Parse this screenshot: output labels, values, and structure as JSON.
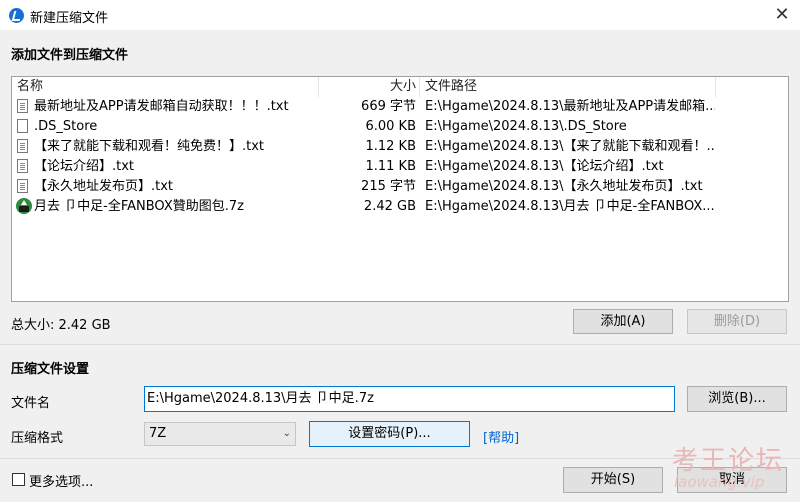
{
  "window": {
    "title": "新建压缩文件",
    "close_glyph": "✕"
  },
  "add_section": {
    "heading": "添加文件到压缩文件",
    "columns": {
      "name": "名称",
      "size": "大小",
      "path": "文件路径"
    },
    "files": [
      {
        "icon": "text-file-icon",
        "name": "最新地址及APP请发邮箱自动获取！！！.txt",
        "size": "669 字节",
        "path": "E:\\Hgame\\2024.8.13\\最新地址及APP请发邮箱..."
      },
      {
        "icon": "blank-file-icon",
        "name": ".DS_Store",
        "size": "6.00 KB",
        "path": "E:\\Hgame\\2024.8.13\\.DS_Store"
      },
      {
        "icon": "text-file-icon",
        "name": "【来了就能下载和观看！纯免费！】.txt",
        "size": "1.12 KB",
        "path": "E:\\Hgame\\2024.8.13\\【来了就能下载和观看！..."
      },
      {
        "icon": "text-file-icon",
        "name": "【论坛介绍】.txt",
        "size": "1.11 KB",
        "path": "E:\\Hgame\\2024.8.13\\【论坛介绍】.txt"
      },
      {
        "icon": "text-file-icon",
        "name": "【永久地址发布页】.txt",
        "size": "215 字节",
        "path": "E:\\Hgame\\2024.8.13\\【永久地址发布页】.txt"
      },
      {
        "icon": "7z-archive-icon",
        "name": "月去 卩中足-全FANBOX贊助图包.7z",
        "size": "2.42 GB",
        "path": "E:\\Hgame\\2024.8.13\\月去 卩中足-全FANBOX..."
      }
    ],
    "total_label": "总大小: 2.42 GB",
    "add_button": "添加(A)",
    "delete_button": "删除(D)"
  },
  "settings": {
    "heading": "压缩文件设置",
    "filename_label": "文件名",
    "filename_value": "E:\\Hgame\\2024.8.13\\月去 卩中足.7z",
    "browse_button": "浏览(B)...",
    "format_label": "压缩格式",
    "format_value": "7Z",
    "password_button": "设置密码(P)...",
    "help_link": "[帮助]"
  },
  "footer": {
    "more_options": "更多选项...",
    "start_button": "开始(S)",
    "cancel_button": "取消"
  },
  "watermark": {
    "text_cn": "考王论坛",
    "text_en": "laowang.vip"
  }
}
